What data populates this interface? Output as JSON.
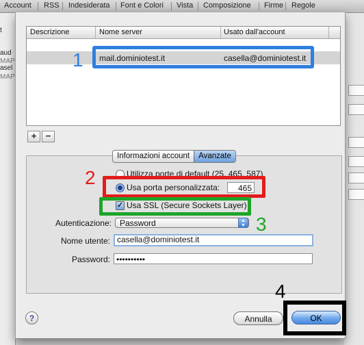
{
  "background_toolbar": {
    "tabs": [
      "Account",
      "RSS",
      "Indesiderata",
      "Font e Colori",
      "Vista",
      "Composizione",
      "Firme",
      "Regole"
    ]
  },
  "background_left": [
    "t",
    "aud",
    "MAP",
    "asel",
    "MAP"
  ],
  "table": {
    "columns": [
      "Descrizione",
      "Nome server",
      "Usato dall'account"
    ],
    "rows": [
      {
        "descrizione": "",
        "nome_server": "mail.dominiotest.it",
        "account": "casella@dominiotest.it"
      }
    ]
  },
  "list_buttons": {
    "add": "+",
    "remove": "−"
  },
  "tabs": {
    "info": "Informazioni account",
    "advanced": "Avanzate"
  },
  "form": {
    "default_ports": "Utilizza porte di default (25, 465, 587)",
    "custom_port_label": "Usa porta personalizzata:",
    "custom_port_value": "465",
    "ssl_label": "Usa SSL (Secure Sockets Layer)",
    "auth_label": "Autenticazione:",
    "auth_value": "Password",
    "username_label": "Nome utente:",
    "username_value": "casella@dominiotest.it",
    "password_label": "Password:",
    "password_value": "••••••••••"
  },
  "buttons": {
    "help": "?",
    "cancel": "Annulla",
    "ok": "OK"
  },
  "annotations": {
    "n1": "1",
    "n2": "2",
    "n3": "3",
    "n4": "4"
  },
  "colors": {
    "blue": "#2f7fe0",
    "red": "#e41c1c",
    "green": "#1ea52a",
    "black": "#000000"
  }
}
